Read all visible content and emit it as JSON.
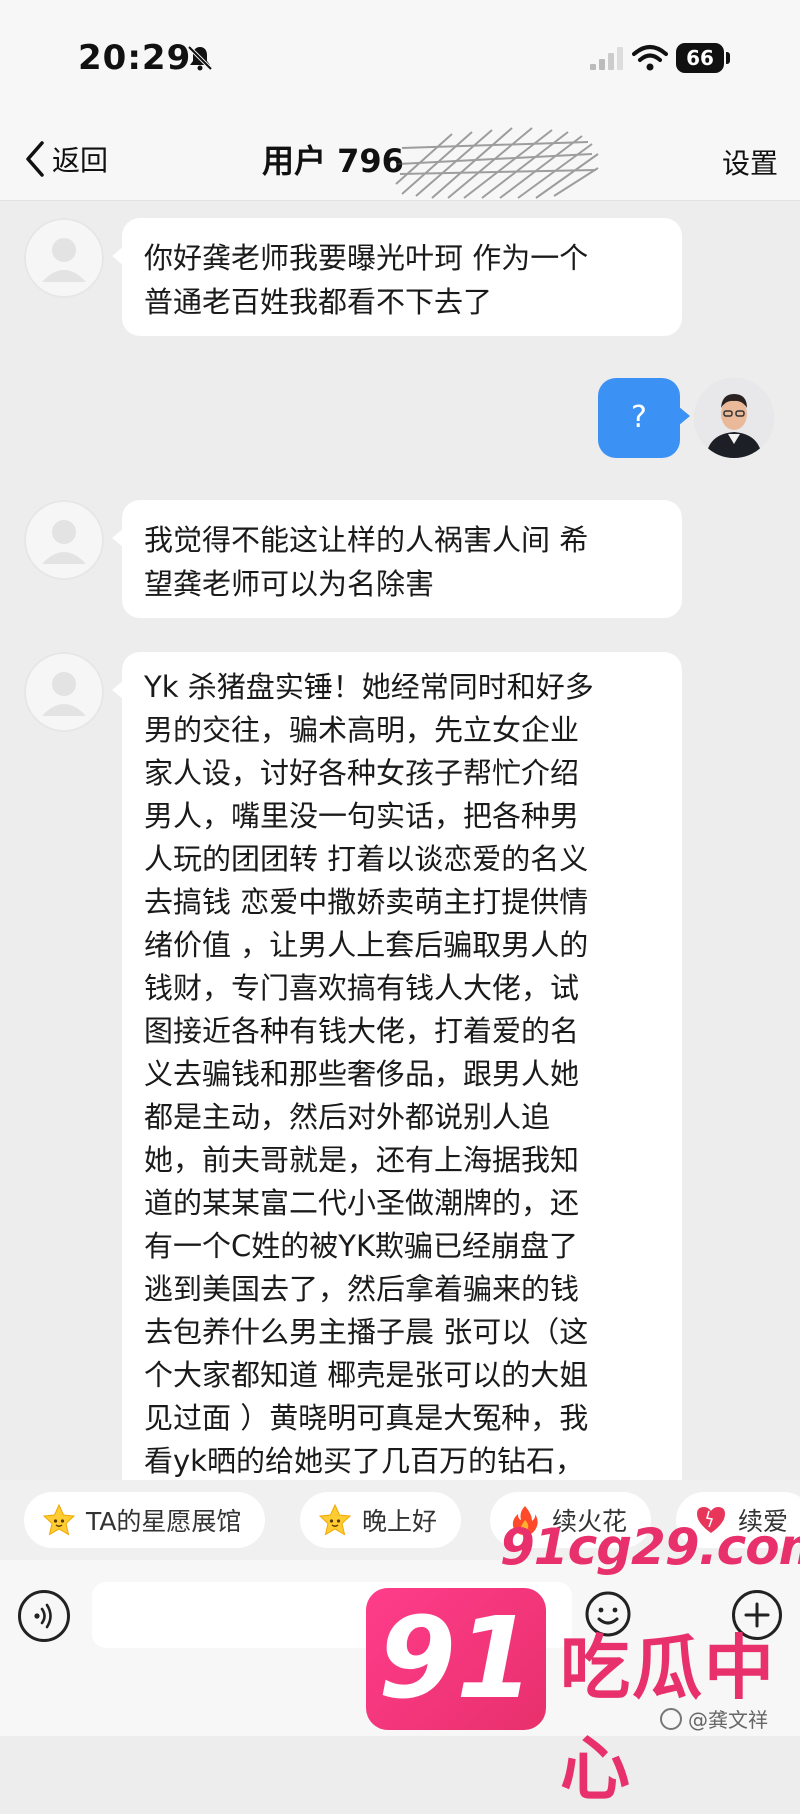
{
  "status_bar": {
    "time": "20:29",
    "battery": "66"
  },
  "nav": {
    "back_label": "返回",
    "title": "用户 796",
    "settings_label": "设置"
  },
  "messages": [
    {
      "side": "in",
      "lines": [
        "你好龚老师我要曝光叶珂 作为一个",
        "普通老百姓我都看不下去了"
      ]
    },
    {
      "side": "out",
      "text": "?"
    },
    {
      "side": "in",
      "lines": [
        "我觉得不能这让样的人祸害人间 希",
        "望龚老师可以为名除害"
      ]
    },
    {
      "side": "in",
      "lines": [
        "Yk 杀猪盘实锤！她经常同时和好多",
        "男的交往，骗术高明，先立女企业",
        "家人设，讨好各种女孩子帮忙介绍",
        "男人，嘴里没一句实话，把各种男",
        "人玩的团团转  打着以谈恋爱的名义",
        "去搞钱 恋爱中撒娇卖萌主打提供情",
        "绪价值 ，让男人上套后骗取男人的",
        "钱财，专门喜欢搞有钱人大佬，试",
        "图接近各种有钱大佬，打着爱的名",
        "义去骗钱和那些奢侈品，跟男人她",
        "都是主动，然后对外都说别人追",
        "她，前夫哥就是，还有上海据我知",
        "道的某某富二代小圣做潮牌的，还",
        "有一个C姓的被YK欺骗已经崩盘了",
        "逃到美国去了，然后拿着骗来的钱",
        "去包养什么男主播子晨 张可以（这",
        "个大家都知道 椰壳是张可以的大姐",
        "见过面 ）黄晓明可真是大冤种，我",
        "看yk晒的给她买了几百万的钻石，"
      ]
    }
  ],
  "quick_chips": [
    {
      "label": "TA的星愿展馆",
      "icon": "star-face-icon"
    },
    {
      "label": "晚上好",
      "icon": "star-face-icon"
    },
    {
      "label": "续火花",
      "icon": "fire-icon"
    },
    {
      "label": "续爱",
      "icon": "heart-icon"
    }
  ],
  "input": {
    "placeholder": ""
  },
  "watermark": {
    "site": "91cg29.com",
    "badge": "91",
    "name": "吃瓜中心",
    "weibo": "@龚文祥"
  },
  "colors": {
    "outgoing_bubble": "#3c91f5",
    "background": "#ededed",
    "watermark": "#e8306c"
  }
}
